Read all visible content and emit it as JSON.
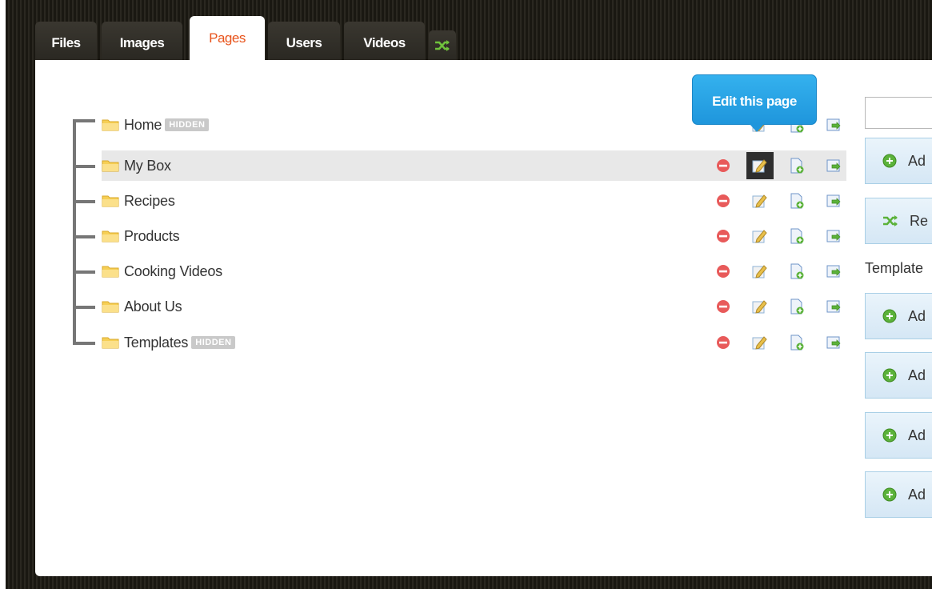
{
  "tabs": [
    {
      "label": "Files"
    },
    {
      "label": "Images"
    },
    {
      "label": "Pages"
    },
    {
      "label": "Users"
    },
    {
      "label": "Videos"
    }
  ],
  "tooltip": {
    "text": "Edit this page"
  },
  "pages": [
    {
      "label": "Home",
      "badge": "HIDDEN"
    },
    {
      "label": "My Box"
    },
    {
      "label": "Recipes"
    },
    {
      "label": "Products"
    },
    {
      "label": "Cooking Videos"
    },
    {
      "label": "About Us"
    },
    {
      "label": "Templates",
      "badge": "HIDDEN"
    }
  ],
  "sidebar": {
    "search_value": "",
    "add_button": "Ad",
    "reorder_button": "Re",
    "templates_label": "Template",
    "template_buttons": [
      "Ad",
      "Ad",
      "Ad",
      "Ad"
    ]
  },
  "colors": {
    "active_tab_text": "#e8541c",
    "tooltip_bg": "#1f96dc",
    "button_bg": "#d5e7f5"
  }
}
